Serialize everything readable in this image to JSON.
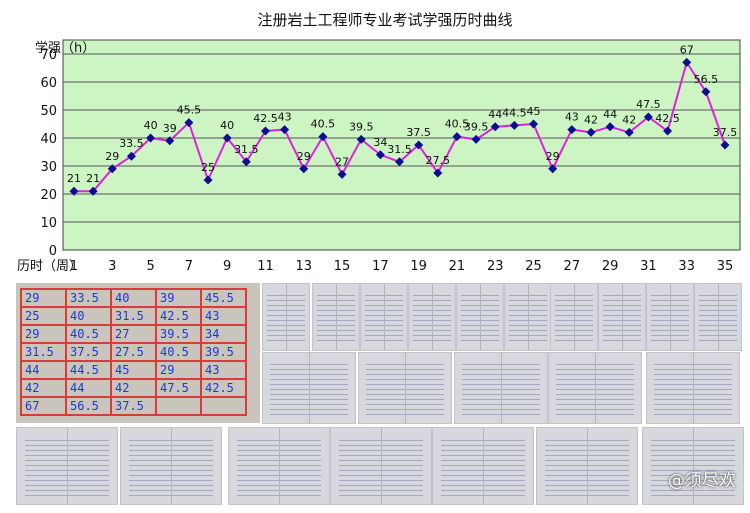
{
  "chart_data": {
    "type": "line",
    "title": "注册岩土工程师专业考试学强历时曲线",
    "ylabel": "学强（h）",
    "xlabel": "历时（周）",
    "x": [
      1,
      2,
      3,
      4,
      5,
      6,
      7,
      8,
      9,
      10,
      11,
      12,
      13,
      14,
      15,
      16,
      17,
      18,
      19,
      20,
      21,
      22,
      23,
      24,
      25,
      26,
      27,
      28,
      29,
      30,
      31,
      32,
      33,
      34,
      35
    ],
    "values": [
      21,
      21,
      29,
      33.5,
      40,
      39,
      45.5,
      25,
      40,
      31.5,
      42.5,
      43,
      29,
      40.5,
      27,
      39.5,
      34,
      31.5,
      37.5,
      27.5,
      40.5,
      39.5,
      44,
      44.5,
      45,
      29,
      43,
      42,
      44,
      42,
      47.5,
      42.5,
      67,
      56.5,
      37.5
    ],
    "data_labels": [
      "21",
      "21",
      "29",
      "33.5",
      "40",
      "39",
      "45.5",
      "25",
      "40",
      "31.5",
      "42.5",
      "43",
      "29",
      "40.5",
      "27",
      "39.5",
      "34",
      "31.5",
      "37.5",
      "27.5",
      "40.5",
      "39.5",
      "44",
      "44.5",
      "45",
      "29",
      "43",
      "42",
      "44",
      "42",
      "47.5",
      "42.5",
      "67",
      "56.5",
      "37.5"
    ],
    "xlim": [
      1,
      35
    ],
    "ylim": [
      0,
      75
    ],
    "y_ticks": [
      0,
      10,
      20,
      30,
      40,
      50,
      60,
      70
    ],
    "x_ticks": [
      1,
      3,
      5,
      7,
      9,
      11,
      13,
      15,
      17,
      19,
      21,
      23,
      25,
      27,
      29,
      31,
      33,
      35
    ],
    "grid": true,
    "colors": {
      "line": "#e020e0",
      "marker": "#0d0d8f",
      "plot_bg": "#ccf5c3",
      "grid": "#555555"
    }
  },
  "photo_grid": {
    "tally_rows": [
      [
        "29",
        "33.5",
        "40",
        "39",
        "45.5"
      ],
      [
        "25",
        "40",
        "31.5",
        "42.5",
        "43"
      ],
      [
        "29",
        "40.5",
        "27",
        "39.5",
        "34"
      ],
      [
        "31.5",
        "37.5",
        "27.5",
        "40.5",
        "39.5"
      ],
      [
        "44",
        "44.5",
        "45",
        "29",
        "43"
      ],
      [
        "42",
        "44",
        "42",
        "47.5",
        "42.5"
      ],
      [
        "67",
        "56.5",
        "37.5",
        "",
        ""
      ]
    ]
  },
  "watermark": "@须尽欢"
}
